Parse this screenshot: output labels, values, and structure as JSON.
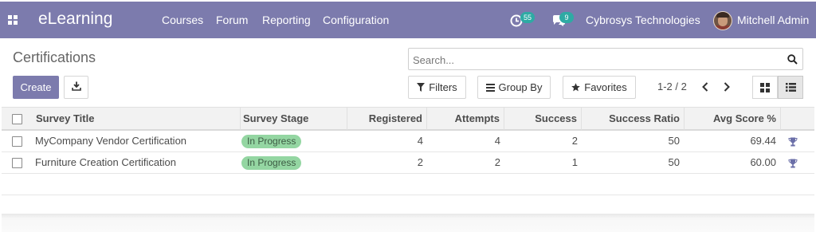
{
  "navbar": {
    "app_name": "eLearning",
    "menu": [
      "Courses",
      "Forum",
      "Reporting",
      "Configuration"
    ],
    "activity_count": "55",
    "message_count": "9",
    "company": "Cybrosys Technologies",
    "user": "Mitchell Admin"
  },
  "control_panel": {
    "title": "Certifications",
    "search_placeholder": "Search...",
    "create_label": "Create",
    "filters_label": "Filters",
    "group_by_label": "Group By",
    "favorites_label": "Favorites",
    "pager": "1-2 / 2"
  },
  "table": {
    "columns": [
      "Survey Title",
      "Survey Stage",
      "Registered",
      "Attempts",
      "Success",
      "Success Ratio",
      "Avg Score %"
    ],
    "rows": [
      {
        "title": "MyCompany Vendor Certification",
        "stage": "In Progress",
        "registered": "4",
        "attempts": "4",
        "success": "2",
        "ratio": "50",
        "avg": "69.44"
      },
      {
        "title": "Furniture Creation Certification",
        "stage": "In Progress",
        "registered": "2",
        "attempts": "2",
        "success": "1",
        "ratio": "50",
        "avg": "60.00"
      }
    ]
  },
  "colors": {
    "brand": "#7c7bad",
    "stage_badge": "#94d6a2",
    "counter_badge": "#2eaaa4"
  },
  "icons": [
    "apps-grid-icon",
    "activity-clock-icon",
    "chat-icon",
    "search-icon",
    "download-icon",
    "filter-icon",
    "group-by-icon",
    "star-icon",
    "chevron-left-icon",
    "chevron-right-icon",
    "kanban-view-icon",
    "list-view-icon",
    "trophy-icon"
  ]
}
